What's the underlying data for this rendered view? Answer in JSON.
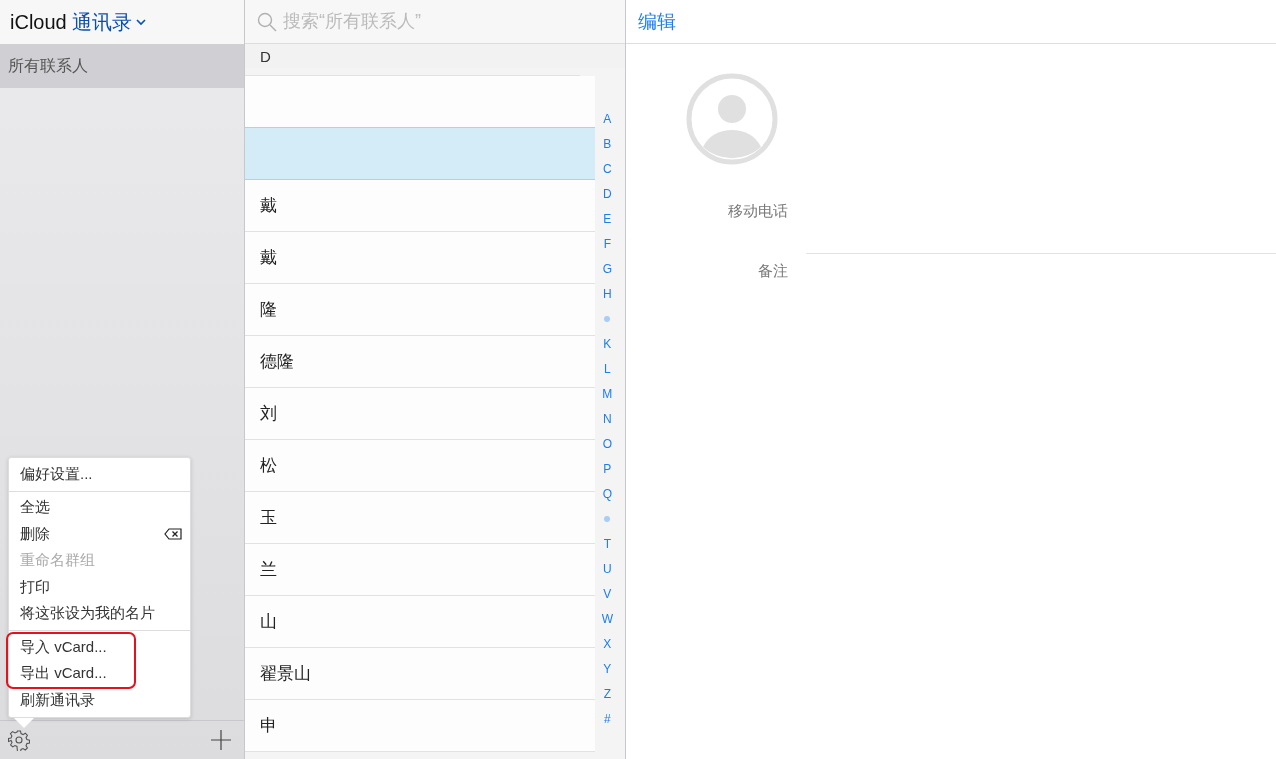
{
  "sidebar": {
    "brand": "iCloud",
    "app_title": "通讯录",
    "groups": [
      {
        "label": "所有联系人",
        "selected": true
      }
    ]
  },
  "menu": {
    "sections": [
      {
        "items": [
          {
            "label": "偏好设置...",
            "disabled": false,
            "highlight": false
          }
        ]
      },
      {
        "items": [
          {
            "label": "全选",
            "disabled": false,
            "highlight": false
          },
          {
            "label": "删除",
            "disabled": false,
            "highlight": false,
            "kind": "delete"
          },
          {
            "label": "重命名群组",
            "disabled": true,
            "highlight": false
          },
          {
            "label": "打印",
            "disabled": false,
            "highlight": false
          },
          {
            "label": "将这张设为我的名片",
            "disabled": false,
            "highlight": false
          }
        ]
      },
      {
        "items": [
          {
            "label": "导入 vCard...",
            "disabled": false,
            "highlight": true
          },
          {
            "label": "导出 vCard...",
            "disabled": false,
            "highlight": true
          },
          {
            "label": "刷新通讯录",
            "disabled": false,
            "highlight": false
          }
        ]
      }
    ]
  },
  "list": {
    "search": {
      "placeholder": "搜索“所有联系人”"
    },
    "section_header": "D",
    "rows": [
      {
        "selected": false
      },
      {
        "selected": true
      },
      {
        "name": "戴",
        "selected": false
      },
      {
        "name": "戴",
        "selected": false
      },
      {
        "name": "隆",
        "selected": false
      },
      {
        "name": "德隆",
        "selected": false
      },
      {
        "name": "刘",
        "selected": false
      },
      {
        "name": "松",
        "selected": false
      },
      {
        "name": "玉",
        "selected": false
      },
      {
        "name": "兰",
        "selected": false
      },
      {
        "name": "山",
        "selected": false
      },
      {
        "name": "翟景山",
        "selected": false
      },
      {
        "name": "申",
        "selected": false
      }
    ],
    "index": [
      {
        "kind": "letter",
        "label": "A"
      },
      {
        "kind": "letter",
        "label": "B"
      },
      {
        "kind": "letter",
        "label": "C"
      },
      {
        "kind": "letter",
        "label": "D"
      },
      {
        "kind": "letter",
        "label": "E"
      },
      {
        "kind": "letter",
        "label": "F"
      },
      {
        "kind": "letter",
        "label": "G"
      },
      {
        "kind": "letter",
        "label": "H"
      },
      {
        "kind": "dot"
      },
      {
        "kind": "letter",
        "label": "K"
      },
      {
        "kind": "letter",
        "label": "L"
      },
      {
        "kind": "letter",
        "label": "M"
      },
      {
        "kind": "letter",
        "label": "N"
      },
      {
        "kind": "letter",
        "label": "O"
      },
      {
        "kind": "letter",
        "label": "P"
      },
      {
        "kind": "letter",
        "label": "Q"
      },
      {
        "kind": "dot"
      },
      {
        "kind": "letter",
        "label": "T"
      },
      {
        "kind": "letter",
        "label": "U"
      },
      {
        "kind": "letter",
        "label": "V"
      },
      {
        "kind": "letter",
        "label": "W"
      },
      {
        "kind": "letter",
        "label": "X"
      },
      {
        "kind": "letter",
        "label": "Y"
      },
      {
        "kind": "letter",
        "label": "Z"
      },
      {
        "kind": "letter",
        "label": "#"
      }
    ]
  },
  "detail": {
    "edit_button": "编辑",
    "fields": [
      {
        "label": "移动电话"
      },
      {
        "label": "备注"
      }
    ]
  }
}
